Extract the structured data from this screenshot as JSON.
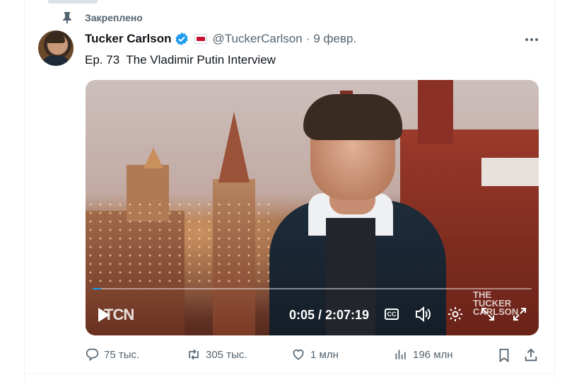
{
  "pinned": {
    "label": "Закреплено"
  },
  "author": {
    "name": "Tucker Carlson",
    "handle": "@TuckerCarlson",
    "separator": "·",
    "date": "9 февр."
  },
  "tweet": {
    "text": "Ep. 73  The Vladimir Putin Interview"
  },
  "video": {
    "logo": "TCN",
    "time": "0:05 / 2:07:19",
    "cc_label": "CC",
    "watermark": "THE\nTUCKER\nCARLSON",
    "progress": 0.0007
  },
  "actions": {
    "replies": "75 тыс.",
    "retweets": "305 тыс.",
    "likes": "1 млн",
    "views": "196 млн"
  },
  "colors": {
    "accent": "#1d9bf0",
    "secondary_text": "#536471",
    "primary_text": "#0f1419"
  }
}
